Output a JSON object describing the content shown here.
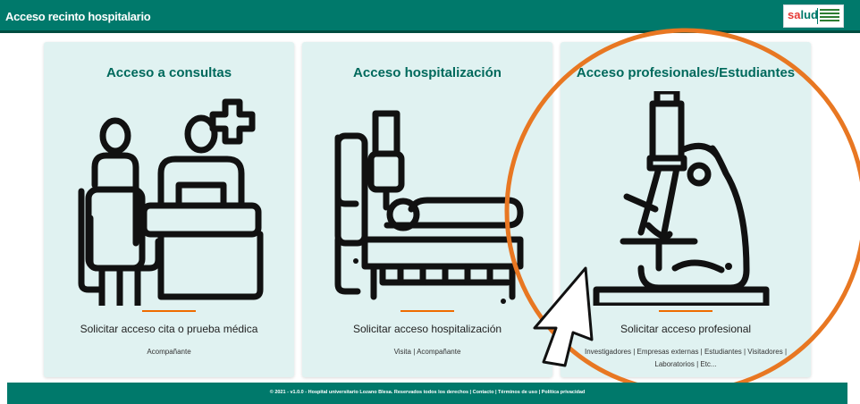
{
  "header": {
    "title": "Acceso recinto hospitalario",
    "logo_text_a": "sa",
    "logo_text_b": "lud"
  },
  "cards": [
    {
      "title": "Acceso a consultas",
      "illustration": "consultation-icon",
      "action": "Solicitar acceso cita o prueba médica",
      "sub": "Acompañante"
    },
    {
      "title": "Acceso hospitalización",
      "illustration": "hospital-bed-icon",
      "action": "Solicitar acceso hospitalización",
      "sub": "Visita | Acompañante"
    },
    {
      "title": "Acceso profesionales/Estudiantes",
      "illustration": "microscope-icon",
      "action": "Solicitar acceso profesional",
      "sub": "Investigadores | Empresas externas | Estudiantes | Visitadores | Laboratorios | Etc..."
    }
  ],
  "footer": {
    "text": "© 2021 - v1.0.0 - Hospital universitario Lozano Blesa. Reservados todos los derechos | Contacto | Términos de uso | Política privacidad"
  },
  "colors": {
    "header": "#00796b",
    "card_bg": "#e0f2f1",
    "title": "#00695c",
    "accent_line": "#ef6c00",
    "highlight_circle": "#e87722"
  }
}
